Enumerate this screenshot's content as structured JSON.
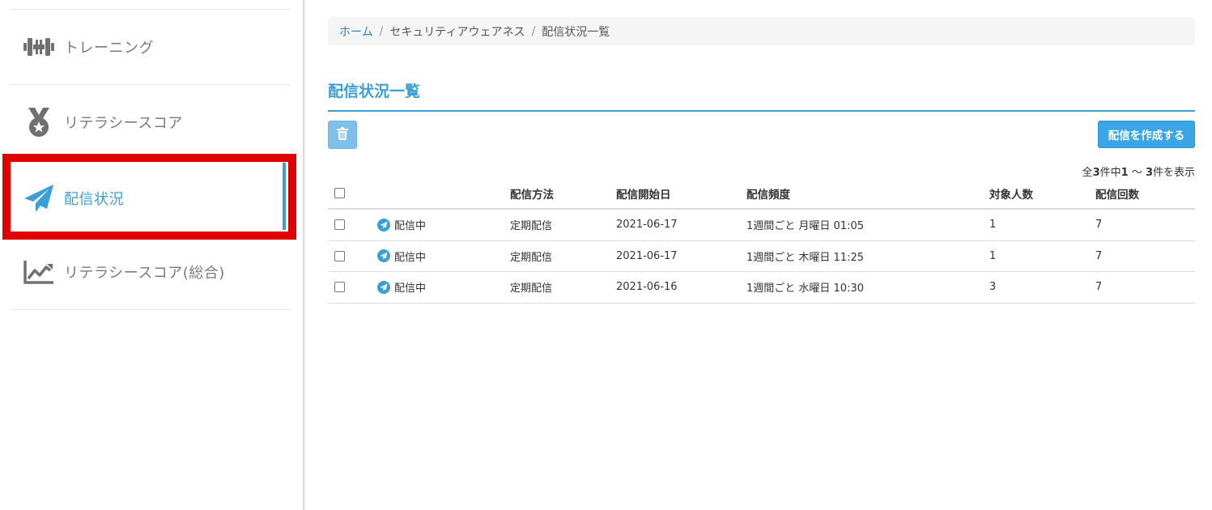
{
  "sidebar": {
    "items": [
      {
        "label": "トレーニング",
        "icon": "dumbbell-icon"
      },
      {
        "label": "リテラシースコア",
        "icon": "medal-icon"
      },
      {
        "label": "配信状況",
        "icon": "paper-plane-icon",
        "active": true
      },
      {
        "label": "リテラシースコア(総合)",
        "icon": "chart-line-icon"
      }
    ]
  },
  "breadcrumb": {
    "items": [
      "ホーム",
      "セキュリティアウェアネス",
      "配信状況一覧"
    ],
    "separator": "/"
  },
  "page_title": "配信状況一覧",
  "toolbar": {
    "delete_icon": "trash-icon",
    "create_label": "配信を作成する"
  },
  "count": {
    "prefix": "全",
    "total": "3",
    "mid": "件中",
    "from": "1",
    "range_sep": " ～ ",
    "to": "3",
    "suffix": "件を表示"
  },
  "table": {
    "headers": {
      "method": "配信方法",
      "start": "配信開始日",
      "frequency": "配信頻度",
      "targets": "対象人数",
      "count": "配信回数"
    },
    "rows": [
      {
        "status": "配信中",
        "method": "定期配信",
        "start": "2021-06-17",
        "frequency": "1週間ごと 月曜日 01:05",
        "targets": "1",
        "count": "7"
      },
      {
        "status": "配信中",
        "method": "定期配信",
        "start": "2021-06-17",
        "frequency": "1週間ごと 木曜日 11:25",
        "targets": "1",
        "count": "7"
      },
      {
        "status": "配信中",
        "method": "定期配信",
        "start": "2021-06-16",
        "frequency": "1週間ごと 水曜日 10:30",
        "targets": "3",
        "count": "7"
      }
    ]
  },
  "colors": {
    "accent": "#3a9fd6",
    "highlight": "#e00000",
    "button": "#3aa6e6"
  }
}
